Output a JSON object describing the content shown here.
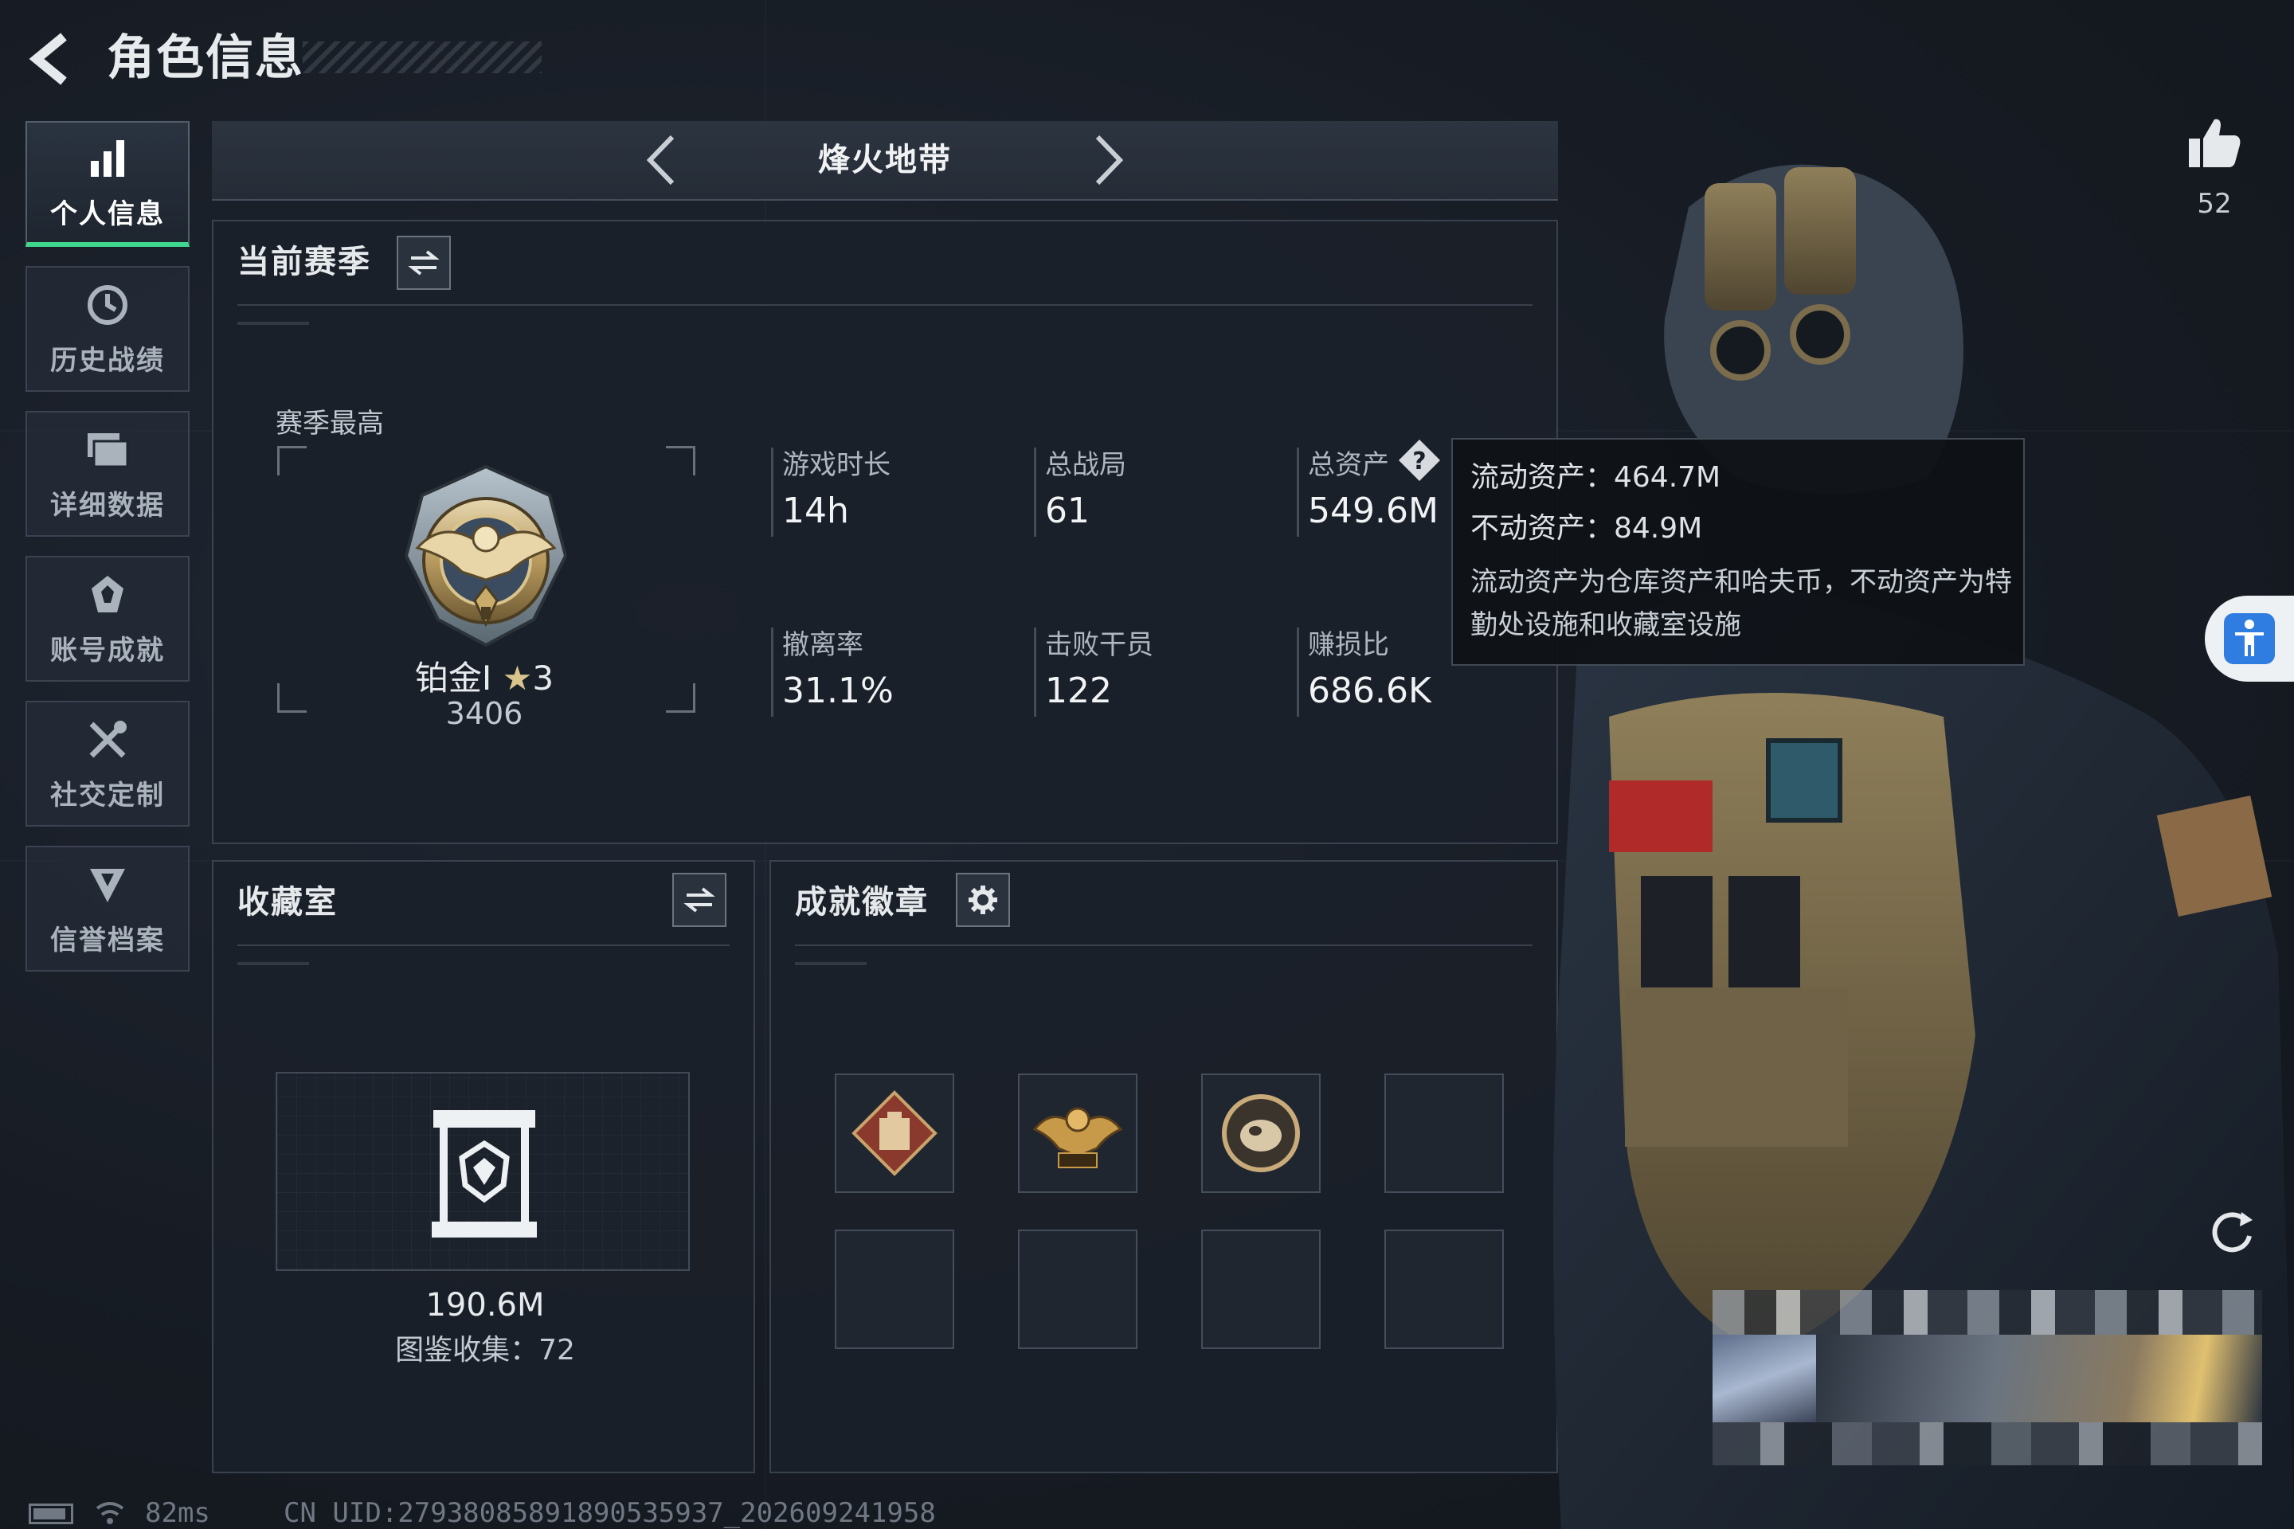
{
  "header": {
    "title": "角色信息"
  },
  "sidebar": {
    "items": [
      {
        "label": "个人信息",
        "icon": "bar-chart-icon",
        "active": true
      },
      {
        "label": "历史战绩",
        "icon": "history-icon",
        "active": false
      },
      {
        "label": "详细数据",
        "icon": "data-folder-icon",
        "active": false
      },
      {
        "label": "账号成就",
        "icon": "achievement-icon",
        "active": false
      },
      {
        "label": "社交定制",
        "icon": "tools-icon",
        "active": false
      },
      {
        "label": "信誉档案",
        "icon": "shield-icon",
        "active": false
      }
    ]
  },
  "mode": {
    "title": "烽火地带"
  },
  "season": {
    "header": "当前赛季",
    "best_label": "赛季最高",
    "rank_name": "铂金Ⅰ",
    "rank_stars": "3",
    "rank_score": "3406",
    "stats": [
      {
        "label": "游戏时长",
        "value": "14h"
      },
      {
        "label": "总战局",
        "value": "61"
      },
      {
        "label": "总资产",
        "value": "549.6M"
      },
      {
        "label": "撤离率",
        "value": "31.1%"
      },
      {
        "label": "击败干员",
        "value": "122"
      },
      {
        "label": "赚损比",
        "value": "686.6K"
      }
    ]
  },
  "tooltip": {
    "liquid": "流动资产：464.7M",
    "fixed": "不动资产：84.9M",
    "desc": "流动资产为仓库资产和哈夫币，不动资产为特勤处设施和收藏室设施"
  },
  "collection": {
    "header": "收藏室",
    "value": "190.6M",
    "catalog": "图鉴收集：72"
  },
  "badges": {
    "header": "成就徽章",
    "items": [
      "supply-badge-icon",
      "eagle-badge-icon",
      "shell-badge-icon",
      "",
      "",
      "",
      "",
      ""
    ]
  },
  "like": {
    "count": "52"
  },
  "status": {
    "ping": "82ms",
    "uid": "CN UID:27938085891890535937_202609241958"
  },
  "colors": {
    "accent_green": "#3fd68e",
    "accessibility_blue": "#2f7de0",
    "background": "#161b23"
  }
}
